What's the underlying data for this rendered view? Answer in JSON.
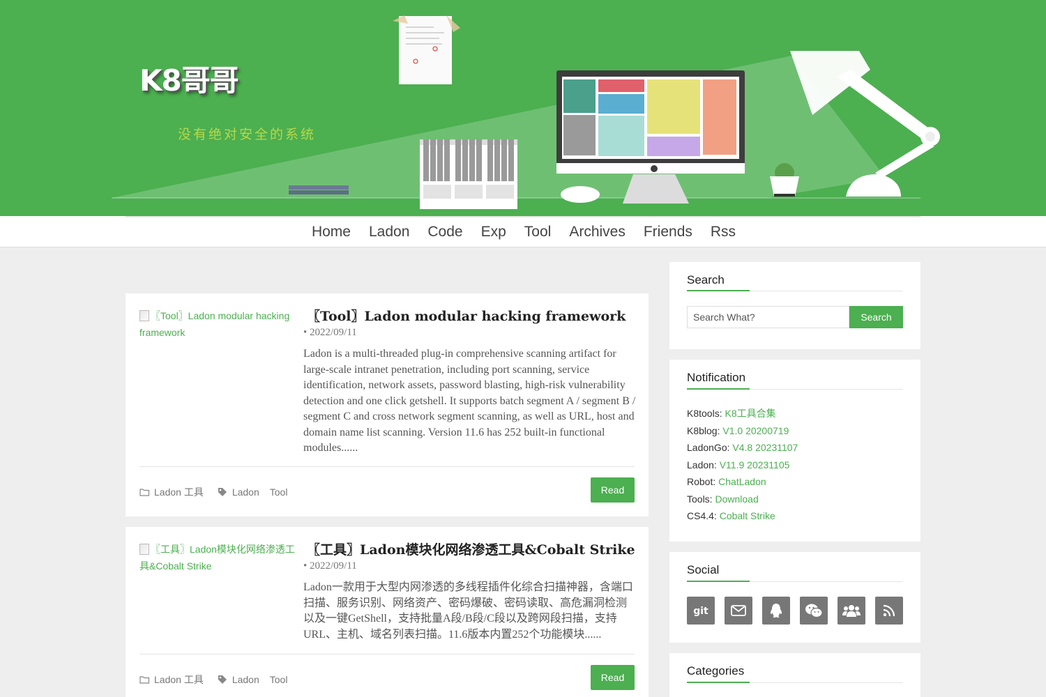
{
  "header": {
    "site_title": "K8哥哥",
    "tagline": "没有绝对安全的系统"
  },
  "nav": {
    "items": [
      "Home",
      "Ladon",
      "Code",
      "Exp",
      "Tool",
      "Archives",
      "Friends",
      "Rss"
    ]
  },
  "posts": [
    {
      "thumb_alt": "〖Tool〗Ladon modular hacking framework",
      "title": "〖Tool〗Ladon modular hacking framework",
      "date": "• 2022/09/11",
      "excerpt": "Ladon is a multi-threaded plug-in comprehensive scanning artifact for large-scale intranet penetration, including port scanning, service identification, network assets, password blasting, high-risk vulnerability detection and one click getshell. It supports batch segment A / segment B / segment C and cross network segment scanning, as well as URL, host and domain name list scanning. Version 11.6 has 252 built-in functional modules......",
      "category": "Ladon 工具",
      "tags": [
        "Ladon",
        "Tool"
      ],
      "read_label": "Read"
    },
    {
      "thumb_alt": "〖工具〗Ladon模块化网络渗透工具&Cobalt Strike",
      "title": "〖工具〗Ladon模块化网络渗透工具&Cobalt Strike",
      "date": "• 2022/09/11",
      "excerpt": "Ladon一款用于大型内网渗透的多线程插件化综合扫描神器，含端口扫描、服务识别、网络资产、密码爆破、密码读取、高危漏洞检测以及一键GetShell，支持批量A段/B段/C段以及跨网段扫描，支持URL、主机、域名列表扫描。11.6版本内置252个功能模块......",
      "category": "Ladon 工具",
      "tags": [
        "Ladon",
        "Tool"
      ],
      "read_label": "Read"
    }
  ],
  "sidebar": {
    "search": {
      "title": "Search",
      "placeholder": "Search What?",
      "button_label": "Search"
    },
    "notification": {
      "title": "Notification",
      "items": [
        {
          "label": "K8tools: ",
          "link": "K8工具合集"
        },
        {
          "label": "K8blog: ",
          "link": "V1.0 20200719"
        },
        {
          "label": "LadonGo: ",
          "link": "V4.8 20231107"
        },
        {
          "label": "Ladon: ",
          "link": "V11.9 20231105"
        },
        {
          "label": "Robot: ",
          "link": "ChatLadon"
        },
        {
          "label": "Tools: ",
          "link": "Download"
        },
        {
          "label": "CS4.4: ",
          "link": "Cobalt Strike"
        }
      ]
    },
    "social": {
      "title": "Social",
      "icons": [
        "git-icon",
        "mail-icon",
        "qq-icon",
        "wechat-icon",
        "group-icon",
        "rss-icon"
      ]
    },
    "categories": {
      "title": "Categories"
    }
  },
  "colors": {
    "accent": "#4caf50",
    "banner": "#4caf50",
    "background": "#eeeeee",
    "social_button": "#777777"
  }
}
